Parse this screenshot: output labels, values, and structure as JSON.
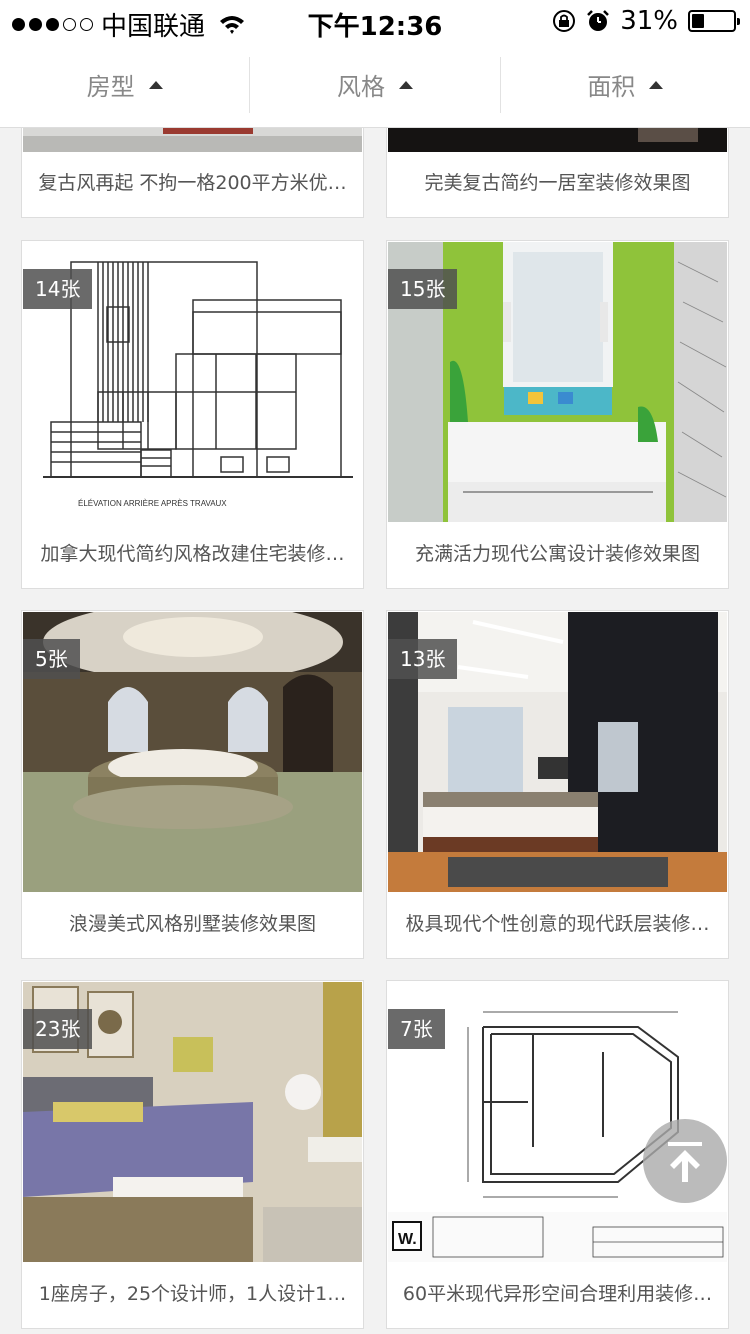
{
  "status_bar": {
    "carrier": "中国联通",
    "time": "下午12:36",
    "battery": "31%",
    "battery_level": 0.31
  },
  "filters": [
    {
      "label": "房型"
    },
    {
      "label": "风格"
    },
    {
      "label": "面积"
    }
  ],
  "cards": [
    {
      "title": "复古风再起 不拘一格200平方米优…",
      "count": ""
    },
    {
      "title": "完美复古简约一居室装修效果图",
      "count": ""
    },
    {
      "title": "加拿大现代简约风格改建住宅装修…",
      "count": "14张"
    },
    {
      "title": "充满活力现代公寓设计装修效果图",
      "count": "15张"
    },
    {
      "title": "浪漫美式风格别墅装修效果图",
      "count": "5张"
    },
    {
      "title": "极具现代个性创意的现代跃层装修…",
      "count": "13张"
    },
    {
      "title": "1座房子，25个设计师，1人设计1…",
      "count": "23张"
    },
    {
      "title": "60平米现代异形空间合理利用装修…",
      "count": "7张"
    }
  ],
  "image_text": {
    "elevation_caption": "ÉLÉVATION ARRIÈRE APRÈS TRAVAUX"
  },
  "icons": {
    "wifi": "wifi-icon",
    "lock": "rotation-lock-icon",
    "alarm": "alarm-icon",
    "back_to_top": "arrow-up-icon"
  }
}
